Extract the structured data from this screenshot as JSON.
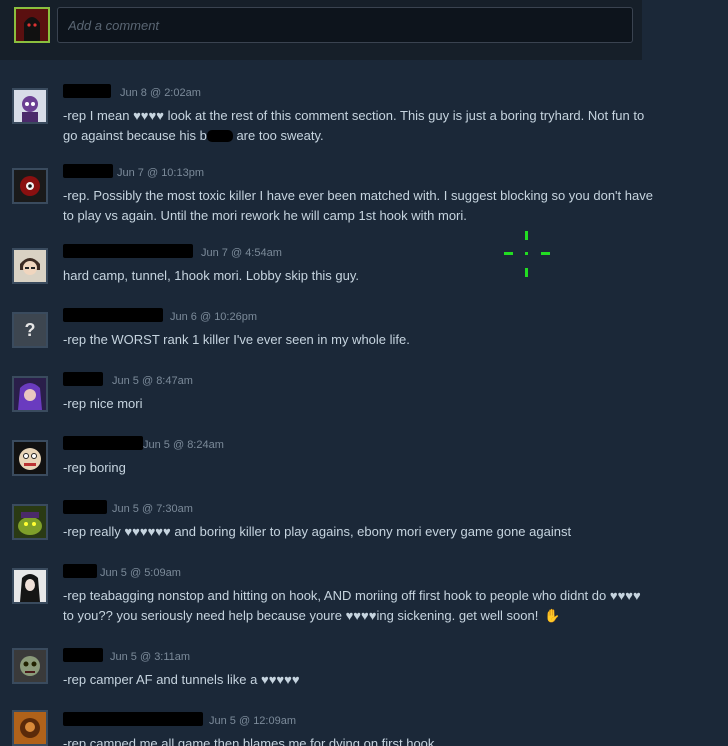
{
  "composer": {
    "placeholder": "Add a comment"
  },
  "comments": [
    {
      "timestamp": "Jun 8 @ 2:02am",
      "text_a": "-rep I mean ♥♥♥♥ look at the rest of this comment section. This guy is just a boring tryhard. Not fun to go against because his b",
      "text_b": " are too sweaty.",
      "avatar": "purple-character-avatar"
    },
    {
      "timestamp": "Jun 7 @ 10:13pm",
      "text": "-rep. Possibly the most toxic killer I have ever been matched with. I suggest blocking so you don't have to play vs again. Until the mori rework he will camp 1st hook with mori.",
      "avatar": "red-eye-avatar"
    },
    {
      "timestamp": "Jun 7 @ 4:54am",
      "text": "hard camp, tunnel, 1hook mori. Lobby skip this guy.",
      "avatar": "anime-face-avatar"
    },
    {
      "timestamp": "Jun 6 @ 10:26pm",
      "text": "-rep the WORST rank 1 killer I've ever seen in my whole life.",
      "avatar": "default-question-avatar",
      "avatar_glyph": "?"
    },
    {
      "timestamp": "Jun 5 @ 8:47am",
      "text": "-rep nice mori",
      "avatar": "purple-hair-avatar"
    },
    {
      "timestamp": "Jun 5 @ 8:24am",
      "text": "-rep boring",
      "avatar": "cartoon-face-avatar"
    },
    {
      "timestamp": "Jun 5 @ 7:30am",
      "text": "-rep really ♥♥♥♥♥♥ and boring killer to play agains, ebony mori every game gone against",
      "avatar": "green-creature-avatar"
    },
    {
      "timestamp": "Jun 5 @ 5:09am",
      "text": "-rep teabagging nonstop and hitting on hook, AND moriing off first hook to people who didnt do ♥♥♥♥ to you?? you seriously need help because youre ♥♥♥♥ing sickening. get well soon!",
      "emoji": "✋",
      "avatar": "dark-hair-avatar"
    },
    {
      "timestamp": "Jun 5 @ 3:11am",
      "text": "-rep camper AF and tunnels like a ♥♥♥♥♥",
      "avatar": "zombie-avatar"
    },
    {
      "timestamp": "Jun 5 @ 12:09am",
      "text": "-rep camped me all game then blames me for dying on first hook",
      "avatar": "orange-portrait-avatar"
    }
  ],
  "colors": {
    "background": "#1b2838",
    "text": "#c6d4df",
    "timestamp": "#7b8a99",
    "crosshair": "#22dd22"
  }
}
